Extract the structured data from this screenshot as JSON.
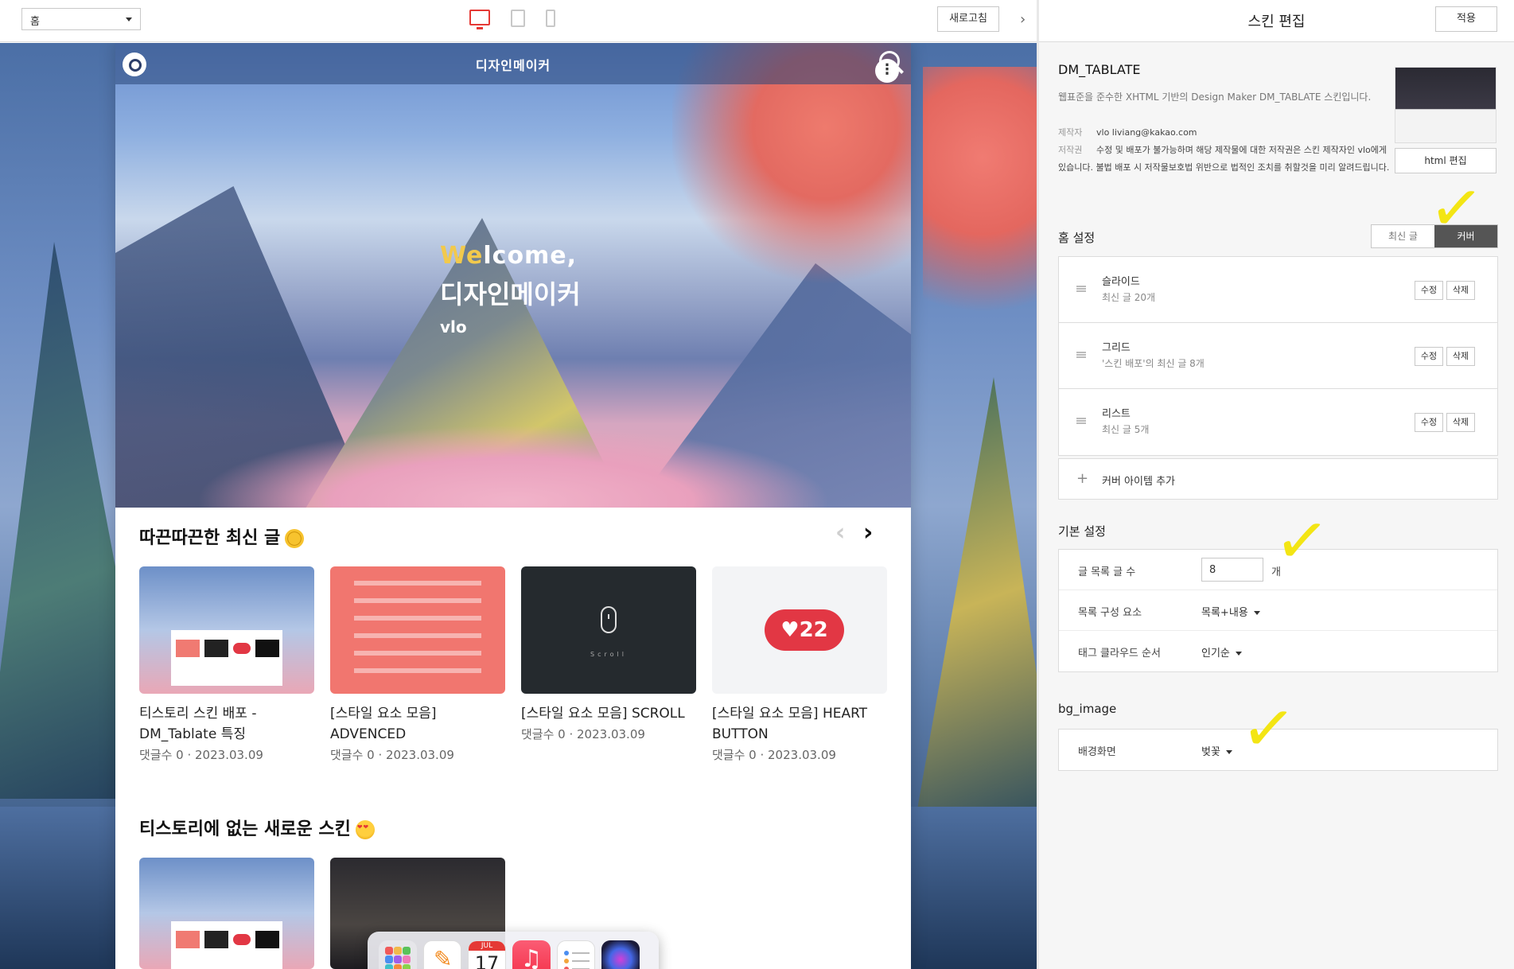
{
  "toolbar": {
    "page_select": "홈",
    "refresh_label": "새로고침",
    "collapse_icon": "chevron-right-icon"
  },
  "site": {
    "title": "디자인메이커",
    "hero": {
      "welcome_hl": "We",
      "welcome_rest": "lcome,",
      "name": "디자인메이커",
      "author": "vlo"
    },
    "sections": [
      {
        "title": "따끈따끈한 최신 글",
        "cards": [
          {
            "title": "티스토리 스킨 배포 - DM_Tablate 특징",
            "meta": "댓글수 0 · 2023.03.09"
          },
          {
            "title": "[스타일 요소 모음] ADVENCED",
            "meta": "댓글수 0 · 2023.03.09"
          },
          {
            "title": "[스타일 요소 모음] SCROLL",
            "meta": "댓글수 0 · 2023.03.09",
            "thumb_text": "Scroll"
          },
          {
            "title": "[스타일 요소 모음] HEART BUTTON",
            "meta": "댓글수 0 · 2023.03.09",
            "thumb_text": "22"
          }
        ]
      },
      {
        "title": "티스토리에 없는 새로운 스킨"
      }
    ]
  },
  "dock": {
    "calendar_month": "JUL",
    "calendar_day": "17",
    "music_glyph": "♫"
  },
  "panel": {
    "title": "스킨 편집",
    "apply_label": "적용",
    "skin_name": "DM_TABLATE",
    "skin_desc": "웹표준을 준수한 XHTML 기반의 Design Maker DM_TABLATE 스킨입니다.",
    "maker_key": "제작자",
    "maker_value": "vlo liviang@kakao.com",
    "copyright_key": "저작권",
    "copyright_value": "수정 및 배포가 불가능하며 해당 제작물에 대한 저작권은 스킨 제작자인 vlo에게 있습니다. 불법 배포 시 저작물보호법 위반으로 법적인 조치를 취할것을 미리 알려드립니다.",
    "html_edit_label": "html 편집",
    "home_setting_label": "홈 설정",
    "home_toggle": [
      "최신 글",
      "커버"
    ],
    "cover_items": [
      {
        "name": "슬라이드",
        "desc": "최신 글 20개"
      },
      {
        "name": "그리드",
        "desc": "'스킨 배포'의 최신 글 8개"
      },
      {
        "name": "리스트",
        "desc": "최신 글 5개"
      }
    ],
    "edit_label": "수정",
    "delete_label": "삭제",
    "add_cover_label": "커버 아이템 추가",
    "basic_setting_label": "기본 설정",
    "basic": {
      "post_count_label": "글 목록 글 수",
      "post_count_value": "8",
      "post_count_unit": "개",
      "list_elem_label": "목록 구성 요소",
      "list_elem_value": "목록+내용",
      "tag_order_label": "태그 클라우드 순서",
      "tag_order_value": "인기순"
    },
    "bg_section_label": "bg_image",
    "bg_label": "배경화면",
    "bg_value": "벚꽃"
  },
  "colors": {
    "accent_red": "#e53935",
    "check_yellow": "#f3e514",
    "toggle_active": "#555555"
  }
}
